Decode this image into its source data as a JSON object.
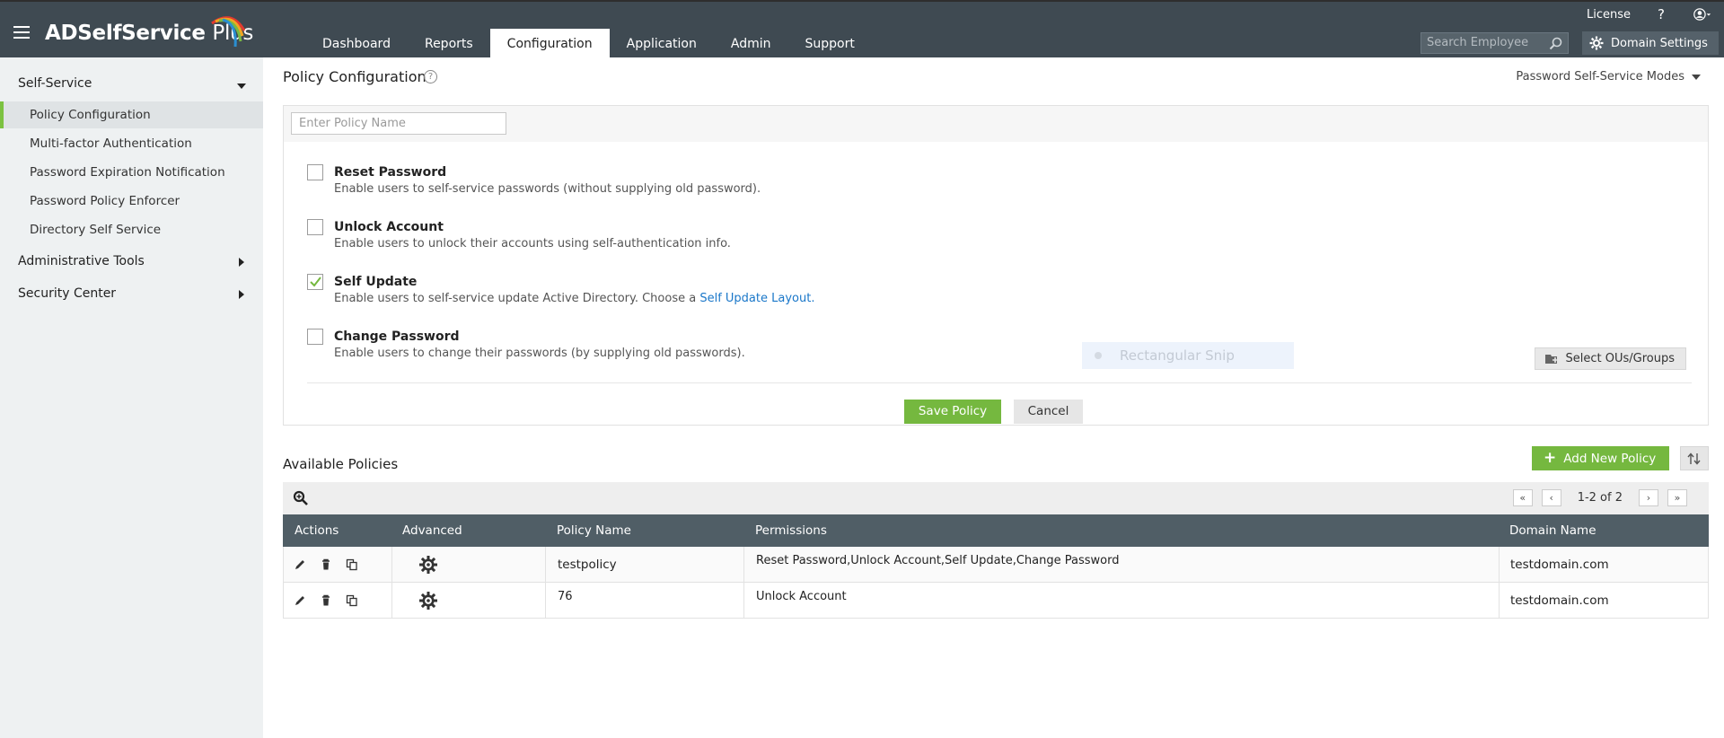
{
  "header": {
    "logo_text": "ADSelfService",
    "logo_plus": "Plus",
    "nav": [
      "Dashboard",
      "Reports",
      "Configuration",
      "Application",
      "Admin",
      "Support"
    ],
    "license": "License",
    "help": "?",
    "search_placeholder": "Search Employee",
    "domain_settings": "Domain Settings"
  },
  "sidebar": {
    "self_service": "Self-Service",
    "items": [
      "Policy Configuration",
      "Multi-factor Authentication",
      "Password Expiration Notification",
      "Password Policy Enforcer",
      "Directory Self Service"
    ],
    "admin_tools": "Administrative Tools",
    "security_center": "Security Center"
  },
  "main": {
    "title": "Policy Configuration",
    "modes": "Password Self-Service Modes",
    "policy_name_placeholder": "Enter Policy Name",
    "options": [
      {
        "title": "Reset Password",
        "desc": "Enable users to self-service passwords (without supplying old password).",
        "checked": false
      },
      {
        "title": "Unlock Account",
        "desc": "Enable users to unlock their accounts using self-authentication info.",
        "checked": false
      },
      {
        "title": "Self Update",
        "desc": "Enable users to self-service update Active Directory. Choose a",
        "link": "Self Update Layout.",
        "checked": true
      },
      {
        "title": "Change Password",
        "desc": "Enable users to change their passwords (by supplying old passwords).",
        "checked": false
      }
    ],
    "snip_overlay": "Rectangular Snip",
    "select_ous": "Select OUs/Groups",
    "save": "Save Policy",
    "cancel": "Cancel",
    "available_title": "Available Policies",
    "add_new": "Add New Policy",
    "pager_text": "1-2 of 2"
  },
  "table": {
    "headers": [
      "Actions",
      "Advanced",
      "Policy Name",
      "Permissions",
      "Domain Name"
    ],
    "rows": [
      {
        "policy": "testpolicy",
        "permissions": "Reset Password,Unlock Account,Self Update,Change Password",
        "domain": "testdomain.com"
      },
      {
        "policy": "76",
        "permissions": "Unlock Account",
        "domain": "testdomain.com"
      }
    ]
  },
  "colors": {
    "header_bg": "#3f4a52",
    "accent_green": "#75b83f",
    "link_blue": "#1a77c9",
    "table_head": "#505e66"
  }
}
